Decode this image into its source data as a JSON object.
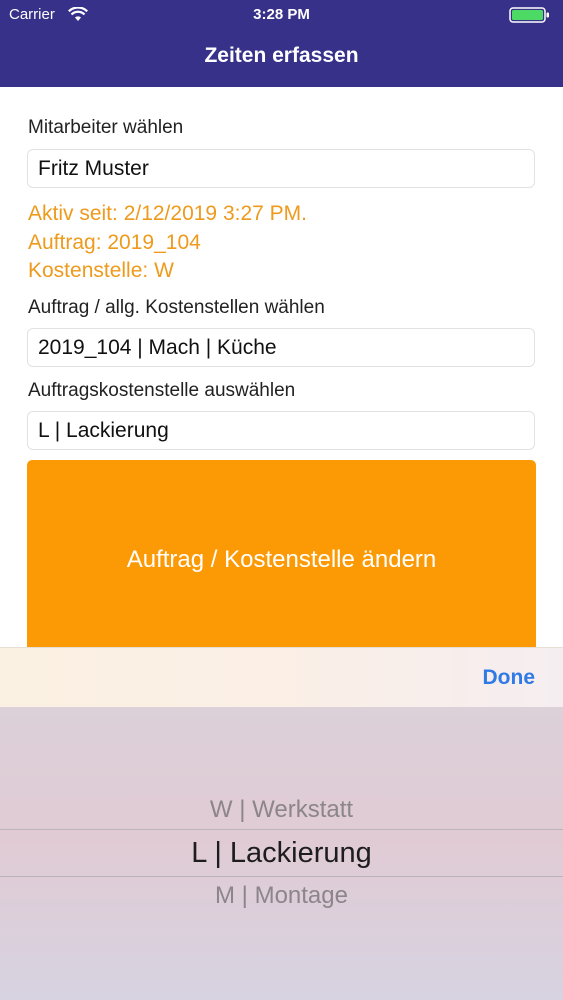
{
  "status": {
    "carrier": "Carrier",
    "time": "3:28 PM"
  },
  "nav": {
    "title": "Zeiten erfassen"
  },
  "employee": {
    "label": "Mitarbeiter wählen",
    "value": "Fritz Muster"
  },
  "active_info": {
    "active_since": "Aktiv seit: 2/12/2019 3:27 PM.",
    "order": "Auftrag: 2019_104",
    "cost_center": "Kostenstelle: W"
  },
  "order_select": {
    "label": "Auftrag / allg. Kostenstellen wählen",
    "value": "2019_104 | Mach | Küche"
  },
  "cost_center_select": {
    "label": "Auftragskostenstelle auswählen",
    "value": "L | Lackierung"
  },
  "change_button": {
    "label": "Auftrag / Kostenstelle ändern"
  },
  "picker": {
    "done_label": "Done",
    "options": [
      "W | Werkstatt",
      "L | Lackierung",
      "M | Montage"
    ],
    "selected": "L | Lackierung"
  },
  "colors": {
    "nav": "#37318a",
    "accent": "#fc9a06",
    "info_text": "#ee9a1c",
    "done": "#2f7ae5"
  }
}
